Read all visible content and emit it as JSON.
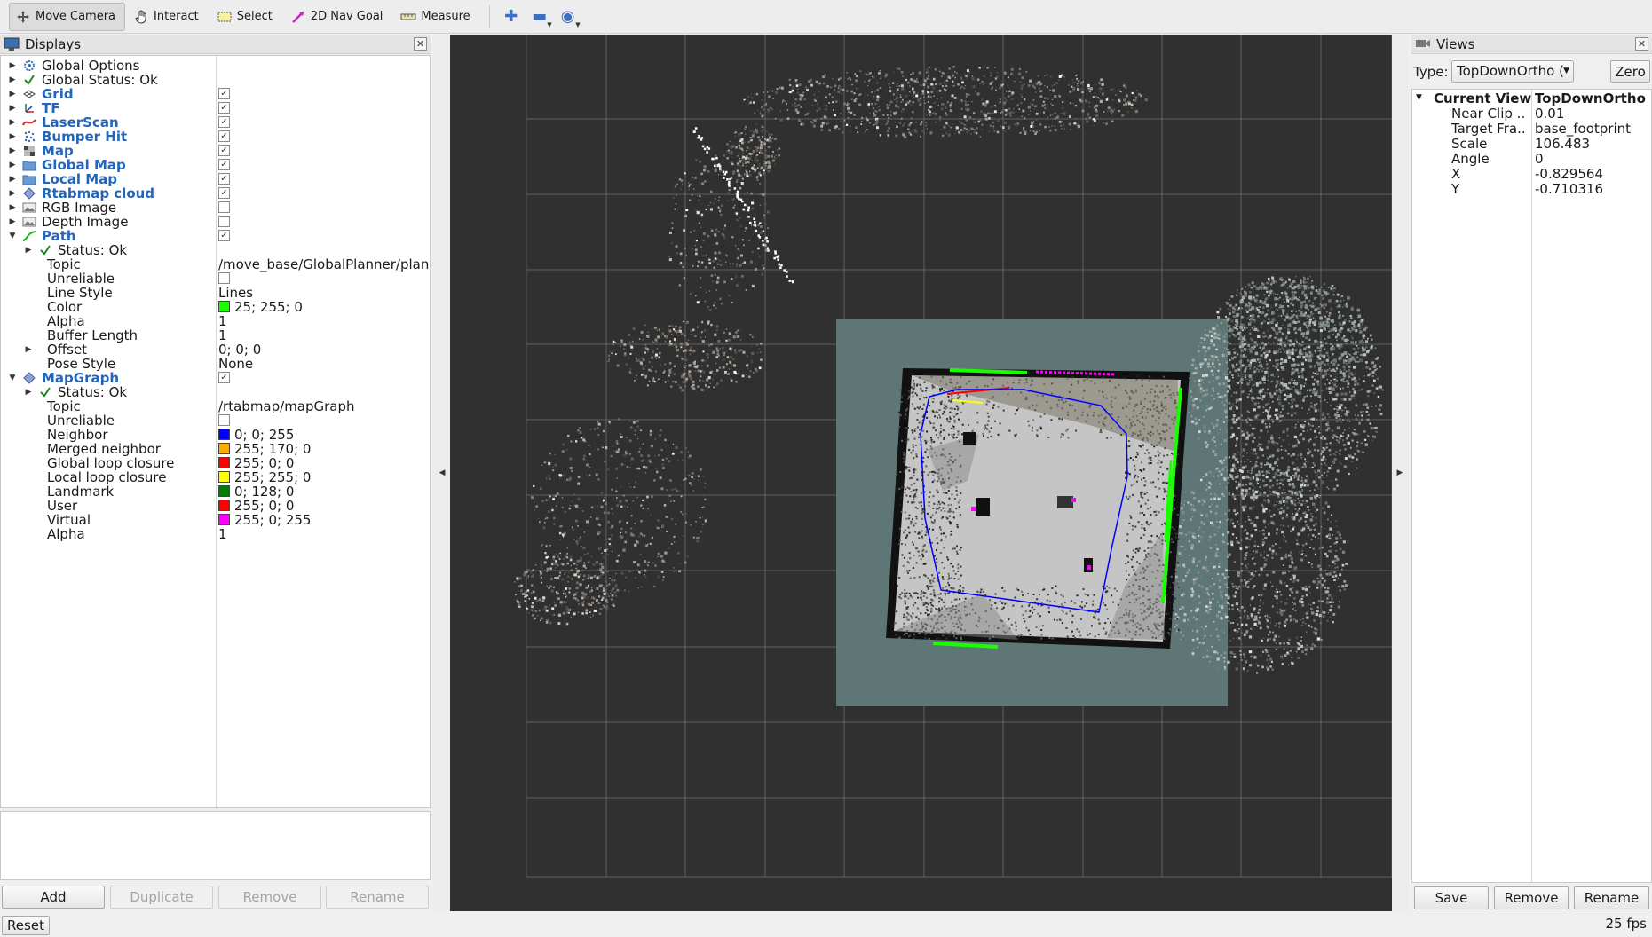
{
  "toolbar": {
    "move_camera": "Move Camera",
    "interact": "Interact",
    "select": "Select",
    "nav_goal": "2D Nav Goal",
    "measure": "Measure"
  },
  "displays": {
    "title": "Displays",
    "items": [
      {
        "label": "Global Options",
        "arrow": "right",
        "icon": "gear-icon",
        "indent": 0,
        "style": "normal"
      },
      {
        "label": "Global Status: Ok",
        "arrow": "right",
        "icon": "check-icon",
        "indent": 0,
        "style": "normal"
      },
      {
        "label": "Grid",
        "arrow": "right",
        "icon": "grid-icon",
        "indent": 0,
        "style": "blue",
        "checked": true
      },
      {
        "label": "TF",
        "arrow": "right",
        "icon": "tf-icon",
        "indent": 0,
        "style": "blue",
        "checked": true
      },
      {
        "label": "LaserScan",
        "arrow": "right",
        "icon": "laserscan-icon",
        "indent": 0,
        "style": "blue",
        "checked": true
      },
      {
        "label": "Bumper Hit",
        "arrow": "right",
        "icon": "pointcloud-icon",
        "indent": 0,
        "style": "blue",
        "checked": true
      },
      {
        "label": "Map",
        "arrow": "right",
        "icon": "map-icon",
        "indent": 0,
        "style": "blue",
        "checked": true
      },
      {
        "label": "Global Map",
        "arrow": "right",
        "icon": "folder-icon",
        "indent": 0,
        "style": "blue",
        "checked": true
      },
      {
        "label": "Local Map",
        "arrow": "right",
        "icon": "folder-icon",
        "indent": 0,
        "style": "blue",
        "checked": true
      },
      {
        "label": "Rtabmap cloud",
        "arrow": "right",
        "icon": "diamond-icon",
        "indent": 0,
        "style": "blue",
        "checked": true
      },
      {
        "label": "RGB Image",
        "arrow": "right",
        "icon": "image-icon",
        "indent": 0,
        "style": "normal",
        "checked": false
      },
      {
        "label": "Depth Image",
        "arrow": "right",
        "icon": "image-icon",
        "indent": 0,
        "style": "normal",
        "checked": false
      },
      {
        "label": "Path",
        "arrow": "down",
        "icon": "path-icon",
        "indent": 0,
        "style": "blue",
        "checked": true
      },
      {
        "label": "Status: Ok",
        "arrow": "right",
        "icon": "check-icon",
        "indent": 1,
        "style": "normal"
      },
      {
        "label": "Topic",
        "indent": 1,
        "style": "prop",
        "value": "/move_base/GlobalPlanner/plan"
      },
      {
        "label": "Unreliable",
        "indent": 1,
        "style": "prop",
        "checked": false
      },
      {
        "label": "Line Style",
        "indent": 1,
        "style": "prop",
        "value": "Lines"
      },
      {
        "label": "Color",
        "indent": 1,
        "style": "prop",
        "value": "25; 255; 0",
        "swatch": "#19ff00"
      },
      {
        "label": "Alpha",
        "indent": 1,
        "style": "prop",
        "value": "1"
      },
      {
        "label": "Buffer Length",
        "indent": 1,
        "style": "prop",
        "value": "1"
      },
      {
        "label": "Offset",
        "arrow": "right",
        "indent": 1,
        "style": "prop",
        "value": "0; 0; 0"
      },
      {
        "label": "Pose Style",
        "indent": 1,
        "style": "prop",
        "value": "None"
      },
      {
        "label": "MapGraph",
        "arrow": "down",
        "icon": "diamond-icon",
        "indent": 0,
        "style": "blue",
        "checked": true
      },
      {
        "label": "Status: Ok",
        "arrow": "right",
        "icon": "check-icon",
        "indent": 1,
        "style": "normal"
      },
      {
        "label": "Topic",
        "indent": 1,
        "style": "prop",
        "value": "/rtabmap/mapGraph"
      },
      {
        "label": "Unreliable",
        "indent": 1,
        "style": "prop",
        "checked": false
      },
      {
        "label": "Neighbor",
        "indent": 1,
        "style": "prop",
        "value": "0; 0; 255",
        "swatch": "#0000ff"
      },
      {
        "label": "Merged neighbor",
        "indent": 1,
        "style": "prop",
        "value": "255; 170; 0",
        "swatch": "#ffaa00"
      },
      {
        "label": "Global loop closure",
        "indent": 1,
        "style": "prop",
        "value": "255; 0; 0",
        "swatch": "#ff0000"
      },
      {
        "label": "Local loop closure",
        "indent": 1,
        "style": "prop",
        "value": "255; 255; 0",
        "swatch": "#ffff00"
      },
      {
        "label": "Landmark",
        "indent": 1,
        "style": "prop",
        "value": "0; 128; 0",
        "swatch": "#008000"
      },
      {
        "label": "User",
        "indent": 1,
        "style": "prop",
        "value": "255; 0; 0",
        "swatch": "#ff0000"
      },
      {
        "label": "Virtual",
        "indent": 1,
        "style": "prop",
        "value": "255; 0; 255",
        "swatch": "#ff00ff"
      },
      {
        "label": "Alpha",
        "indent": 1,
        "style": "prop",
        "value": "1"
      }
    ],
    "buttons": {
      "add": "Add",
      "duplicate": "Duplicate",
      "remove": "Remove",
      "rename": "Rename"
    }
  },
  "views": {
    "title": "Views",
    "type_label": "Type:",
    "type_value": "TopDownOrtho (",
    "zero": "Zero",
    "current_view": {
      "label": "Current View",
      "value": "TopDownOrtho ..."
    },
    "props": [
      {
        "key": "Near Clip ...",
        "value": "0.01"
      },
      {
        "key": "Target Fra...",
        "value": "base_footprint"
      },
      {
        "key": "Scale",
        "value": "106.483"
      },
      {
        "key": "Angle",
        "value": "0"
      },
      {
        "key": "X",
        "value": "-0.829564"
      },
      {
        "key": "Y",
        "value": "-0.710316"
      }
    ],
    "buttons": {
      "save": "Save",
      "remove": "Remove",
      "rename": "Rename"
    }
  },
  "status": {
    "reset": "Reset",
    "fps": "25 fps"
  },
  "colors": {
    "viewport_bg": "#303030",
    "grid_line": "#8a8a8a",
    "costmap": "#5f7676",
    "free_space": "#c4c4c4",
    "path_green": "#19ff00",
    "graph_blue": "#0000ff"
  }
}
